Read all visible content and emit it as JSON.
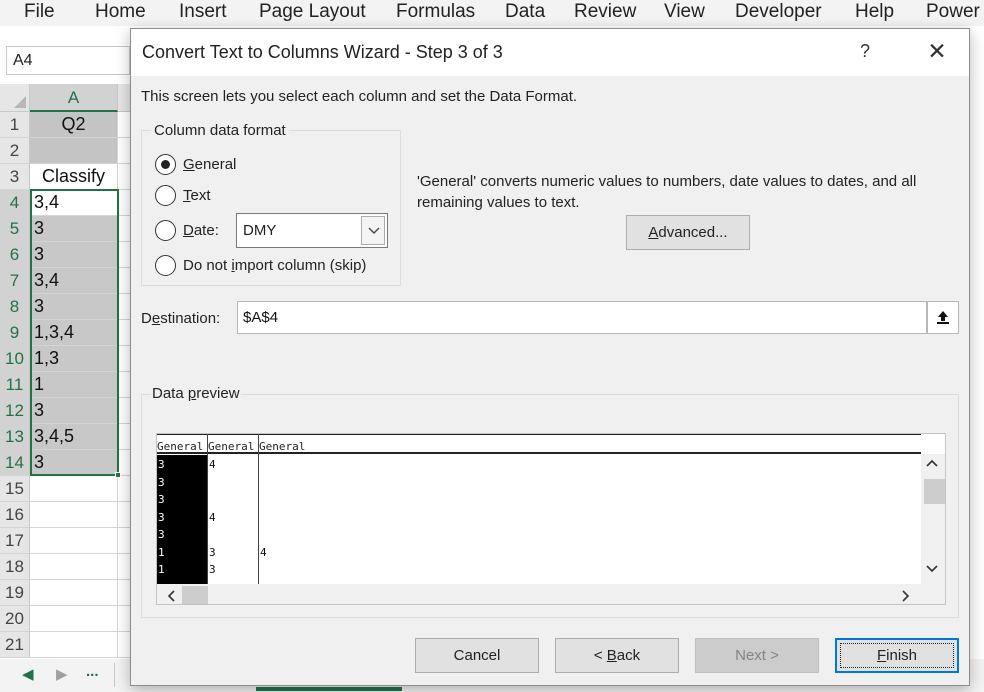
{
  "ribbon": {
    "tabs": [
      "File",
      "Home",
      "Insert",
      "Page Layout",
      "Formulas",
      "Data",
      "Review",
      "View",
      "Developer",
      "Help",
      "Power"
    ]
  },
  "name_box": {
    "value": "A4"
  },
  "sheet": {
    "column_header": "A",
    "rows": [
      {
        "num": "1",
        "value": "Q2"
      },
      {
        "num": "2",
        "value": ""
      },
      {
        "num": "3",
        "value": "Classify"
      },
      {
        "num": "4",
        "value": "3,4"
      },
      {
        "num": "5",
        "value": "3"
      },
      {
        "num": "6",
        "value": "3"
      },
      {
        "num": "7",
        "value": "3,4"
      },
      {
        "num": "8",
        "value": "3"
      },
      {
        "num": "9",
        "value": "1,3,4"
      },
      {
        "num": "10",
        "value": "1,3"
      },
      {
        "num": "11",
        "value": "1"
      },
      {
        "num": "12",
        "value": "3"
      },
      {
        "num": "13",
        "value": "3,4,5"
      },
      {
        "num": "14",
        "value": "3"
      },
      {
        "num": "15",
        "value": ""
      },
      {
        "num": "16",
        "value": ""
      },
      {
        "num": "17",
        "value": ""
      },
      {
        "num": "18",
        "value": ""
      },
      {
        "num": "19",
        "value": ""
      },
      {
        "num": "20",
        "value": ""
      },
      {
        "num": "21",
        "value": ""
      }
    ],
    "tab_nav": {
      "prev": "◀",
      "next": "▶",
      "more": "..."
    }
  },
  "dialog": {
    "title": "Convert Text to Columns Wizard - Step 3 of 3",
    "help": "?",
    "close": "✕",
    "intro": "This screen lets you select each column and set the Data Format.",
    "format_group": {
      "legend": "Column data format",
      "general_label": "General",
      "text_label": "Text",
      "date_label": "Date:",
      "skip_label": "Do not import column (skip)",
      "selected": "general",
      "date_format": "DMY"
    },
    "description": "'General' converts numeric values to numbers, date values to dates, and all remaining values to text.",
    "advanced_button": "Advanced...",
    "destination": {
      "label": "Destination:",
      "value": "$A$4"
    },
    "preview": {
      "legend": "Data preview",
      "headers": [
        "General",
        "General",
        "General"
      ],
      "rows": [
        [
          "3",
          "4",
          ""
        ],
        [
          "3",
          "",
          ""
        ],
        [
          "3",
          "",
          ""
        ],
        [
          "3",
          "4",
          ""
        ],
        [
          "3",
          "",
          ""
        ],
        [
          "1",
          "3",
          "4"
        ],
        [
          "1",
          "3",
          ""
        ]
      ]
    },
    "buttons": {
      "cancel": "Cancel",
      "back": "< Back",
      "next": "Next >",
      "finish": "Finish"
    }
  },
  "colors": {
    "excel_green": "#217346",
    "focus_blue": "#0078d7",
    "dialog_bg": "#f0f0f0"
  }
}
